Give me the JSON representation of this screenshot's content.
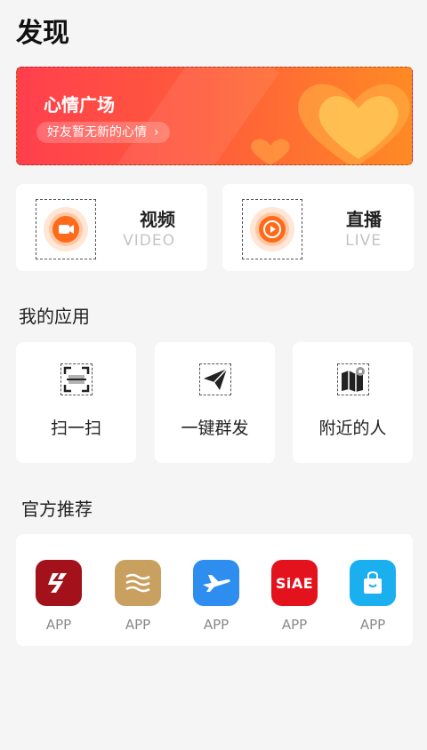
{
  "page": {
    "title": "发现"
  },
  "banner": {
    "title": "心情广场",
    "subtitle": "好友暂无新的心情"
  },
  "media": [
    {
      "title": "视频",
      "subtitle": "VIDEO"
    },
    {
      "title": "直播",
      "subtitle": "LIVE"
    }
  ],
  "my_apps": {
    "title": "我的应用",
    "items": [
      {
        "label": "扫一扫",
        "icon": "scan-icon"
      },
      {
        "label": "一键群发",
        "icon": "paper-plane-icon"
      },
      {
        "label": "附近的人",
        "icon": "map-pin-icon"
      }
    ]
  },
  "recommended": {
    "title": "官方推荐",
    "items": [
      {
        "label": "APP",
        "icon": "s-logo-icon",
        "color": "#a3121b"
      },
      {
        "label": "APP",
        "icon": "waves-logo-icon",
        "color": "#c9a060"
      },
      {
        "label": "APP",
        "icon": "airplane-icon",
        "color": "#2d8ef0"
      },
      {
        "label": "APP",
        "icon": "siae-logo-icon",
        "logo_text": "SiAE",
        "color": "#e3121d"
      },
      {
        "label": "APP",
        "icon": "shopping-bag-icon",
        "color": "#1ab0ef"
      }
    ]
  },
  "colors": {
    "accent": "#ff6a1a",
    "banner_start": "#ff3f4d",
    "banner_end": "#ff8a24"
  }
}
